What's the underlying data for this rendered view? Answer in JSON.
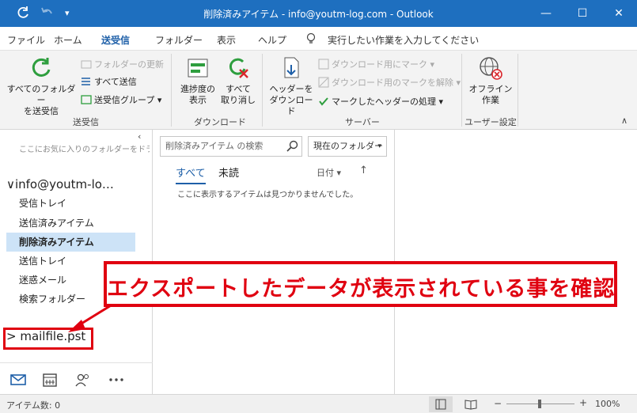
{
  "titlebar": {
    "title": "削除済みアイテム - info@youtm-log.com  -  Outlook",
    "minimize": "—",
    "maximize": "☐",
    "close": "✕"
  },
  "menu": {
    "tabs": [
      "ファイル",
      "ホーム",
      "送受信",
      "フォルダー",
      "表示",
      "ヘルプ"
    ],
    "active_tab": "送受信",
    "tell_me": "実行したい作業を入力してください"
  },
  "ribbon": {
    "send_receive_all": "すべてのフォルダー\nを送受信",
    "update_folder": "フォルダーの更新",
    "send_all": "すべて送信",
    "send_receive_groups": "送受信グループ ▾",
    "group_send_receive": "送受信",
    "show_progress": "進捗度の\n表示",
    "cancel_all": "すべて\n取り消し",
    "group_download": "ダウンロード",
    "download_headers": "ヘッダーを\nダウンロード",
    "mark_to_download": "ダウンロード用にマーク ▾",
    "unmark_to_download": "ダウンロード用のマークを解除 ▾",
    "process_marked_headers": "マークしたヘッダーの処理 ▾",
    "group_server": "サーバー",
    "work_offline": "オフライン\n作業",
    "group_preferences": "ユーザー設定"
  },
  "nav": {
    "favorites_hint": "ここにお気に入りのフォルダーをドラッ",
    "collapse": "‹",
    "account": "∨info@youtm-lo…",
    "folders": [
      "受信トレイ",
      "送信済みアイテム",
      "削除済みアイテム",
      "送信トレイ",
      "迷惑メール",
      "検索フォルダー"
    ],
    "selected_folder": "削除済みアイテム",
    "pst": "> mailfile.pst"
  },
  "list": {
    "search_placeholder": "削除済みアイテム の検索",
    "scope": "現在のフォルダー",
    "scope_caret": "▾",
    "tab_all": "すべて",
    "tab_unread": "未読",
    "sort_by": "日付 ▾",
    "sort_dir": "↑",
    "empty_message": "ここに表示するアイテムは見つかりませんでした。"
  },
  "status": {
    "item_count": "アイテム数: 0",
    "zoom": "100%"
  },
  "annotation": {
    "banner_text": "エクスポートしたデータが表示されている事を確認"
  },
  "colors": {
    "titlebar": "#1e6fbf",
    "accent": "#1e5fa8",
    "selected_folder_bg": "#cde3f7",
    "annotation_red": "#e00010"
  }
}
